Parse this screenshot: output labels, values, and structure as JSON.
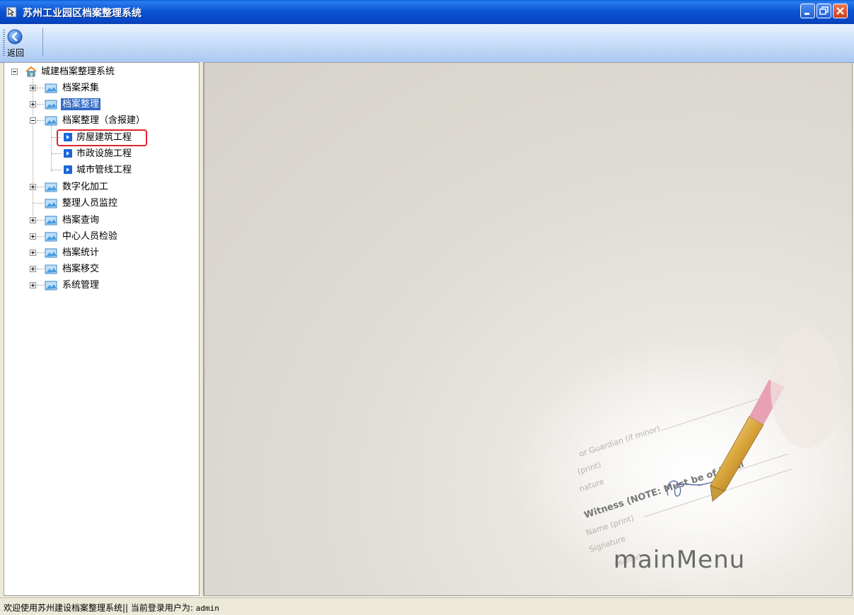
{
  "window": {
    "title": "苏州工业园区档案整理系统",
    "controls": [
      "minimize",
      "restore",
      "close"
    ]
  },
  "toolbar": {
    "back_label": "返回",
    "back_icon": "back-arrow-icon"
  },
  "tree": {
    "root": {
      "label": "城建档案整理系统",
      "icon": "home-icon",
      "expanded": true
    },
    "nodes": [
      {
        "label": "档案采集",
        "expandable": true,
        "expanded": false
      },
      {
        "label": "档案整理",
        "expandable": true,
        "expanded": false,
        "selected": true
      },
      {
        "label": "档案整理（含报建）",
        "expandable": true,
        "expanded": true,
        "children": [
          {
            "label": "房屋建筑工程",
            "highlighted": true
          },
          {
            "label": "市政设施工程"
          },
          {
            "label": "城市管线工程"
          }
        ]
      },
      {
        "label": "数字化加工",
        "expandable": true,
        "expanded": false
      },
      {
        "label": "整理人员监控",
        "expandable": false
      },
      {
        "label": "档案查询",
        "expandable": true,
        "expanded": false
      },
      {
        "label": "中心人员检验",
        "expandable": true,
        "expanded": false
      },
      {
        "label": "档案统计",
        "expandable": true,
        "expanded": false
      },
      {
        "label": "档案移交",
        "expandable": true,
        "expanded": false
      },
      {
        "label": "系统管理",
        "expandable": true,
        "expanded": false
      }
    ]
  },
  "main": {
    "banner_title": "mainMenu",
    "document_lines": [
      "or Guardian (if minor)",
      "(print)",
      "nature",
      "Witness (NOTE: Must be of legal",
      "Name (print)",
      "Signature",
      "06/20 v5"
    ]
  },
  "status": {
    "prefix": "欢迎使用苏州建设档案整理系统|| 当前登录用户为: ",
    "user": "admin"
  },
  "colors": {
    "titlebar": "#0a55d4",
    "selection": "#316ac5",
    "highlight_border": "#e0242c",
    "leaf_icon": "#1a67d8"
  }
}
